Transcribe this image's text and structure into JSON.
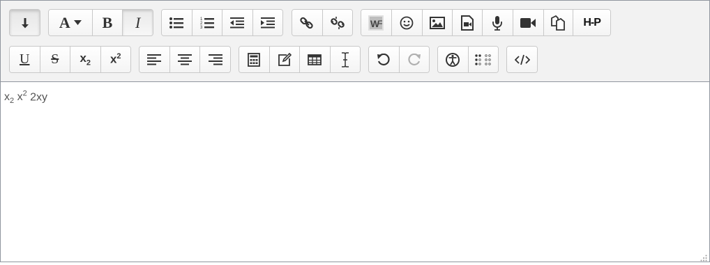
{
  "toolbar": {
    "row1": {
      "collapse": {
        "icon": "collapse-arrow-icon"
      },
      "text_style": {
        "font_label": "A",
        "bold_label": "B",
        "italic_label": "I"
      },
      "lists": [
        "unordered-list-icon",
        "ordered-list-icon",
        "outdent-icon",
        "indent-icon"
      ],
      "links": [
        "link-icon",
        "unlink-icon"
      ],
      "media": [
        "word-import-icon",
        "emoticon-icon",
        "image-icon",
        "media-file-icon",
        "record-audio-icon",
        "record-video-icon",
        "manage-files-icon",
        "h5p-icon"
      ],
      "h5p_label": "H-P"
    },
    "row2": {
      "format": {
        "underline_label": "U",
        "strike_label": "S",
        "subscript_base": "x",
        "subscript_mark": "2",
        "superscript_base": "x",
        "superscript_mark": "2"
      },
      "align": [
        "align-left-icon",
        "align-center-icon",
        "align-right-icon"
      ],
      "insert": [
        "equation-editor-icon",
        "edit-icon",
        "table-icon",
        "cursor-text-icon"
      ],
      "history": [
        "undo-icon",
        "redo-icon"
      ],
      "accessibility": [
        "accessibility-checker-icon",
        "braille-icon"
      ],
      "html": [
        "html-source-icon"
      ]
    }
  },
  "content": {
    "sub_base": "x",
    "sub_value": "2",
    "sup_base": "x",
    "sup_value": "2",
    "text": "2xy"
  }
}
